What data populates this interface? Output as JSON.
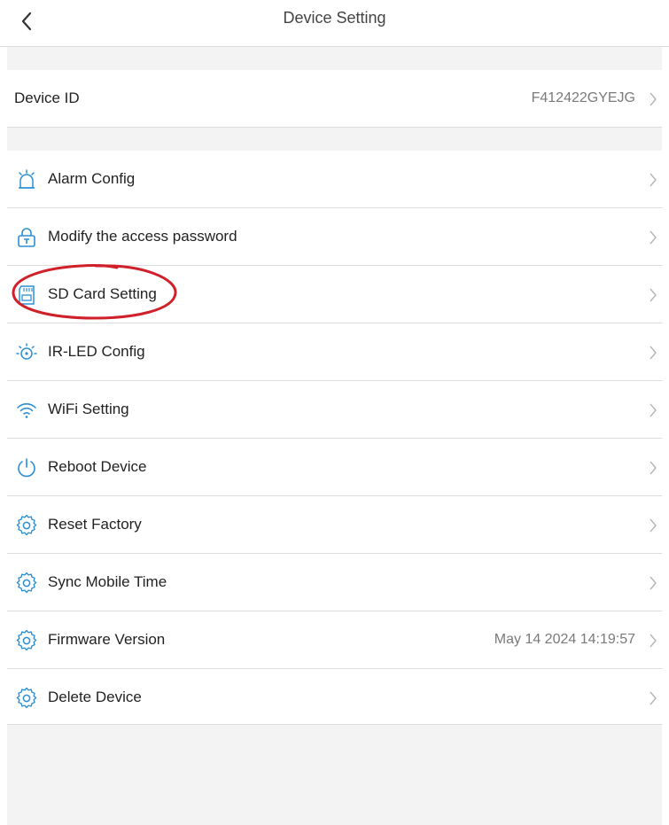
{
  "header": {
    "title": "Device Setting"
  },
  "device_id": {
    "label": "Device ID",
    "value": "F412422GYEJG"
  },
  "menu": [
    {
      "label": "Alarm Config",
      "icon": "alarm-icon",
      "value": ""
    },
    {
      "label": "Modify the access password",
      "icon": "lock-icon",
      "value": ""
    },
    {
      "label": "SD Card Setting",
      "icon": "sd-card-icon",
      "value": "",
      "highlighted": true
    },
    {
      "label": "IR-LED Config",
      "icon": "ir-led-icon",
      "value": ""
    },
    {
      "label": "WiFi Setting",
      "icon": "wifi-icon",
      "value": ""
    },
    {
      "label": "Reboot Device",
      "icon": "power-icon",
      "value": ""
    },
    {
      "label": "Reset Factory",
      "icon": "gear-icon",
      "value": ""
    },
    {
      "label": "Sync Mobile Time",
      "icon": "gear-icon",
      "value": ""
    },
    {
      "label": "Firmware Version",
      "icon": "gear-icon",
      "value": "May 14 2024 14:19:57"
    },
    {
      "label": "Delete Device",
      "icon": "gear-icon",
      "value": ""
    }
  ],
  "colors": {
    "accent": "#2c8fd6",
    "annotation": "#d0202a",
    "chevron": "#b5b5b5",
    "section_gap": "#f3f3f3"
  }
}
